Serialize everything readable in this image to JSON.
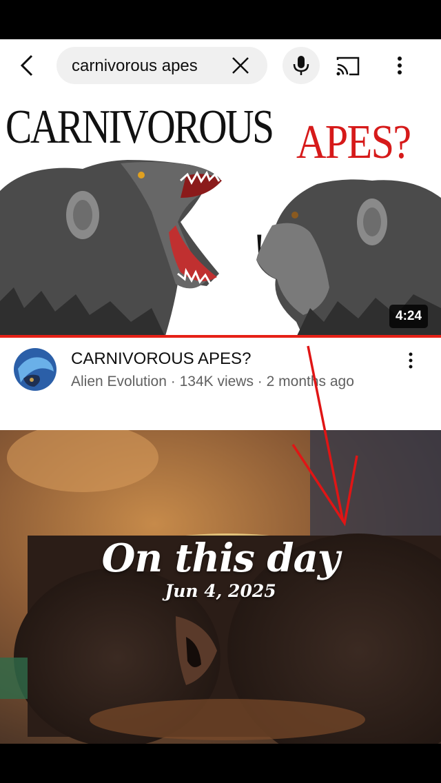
{
  "search": {
    "query": "carnivorous apes"
  },
  "video": {
    "thumbnail_title_black": "CARNIVOROUS",
    "thumbnail_title_red": "APES?",
    "thumbnail_exclaim": "!",
    "duration": "4:24",
    "title": "CARNIVOROUS APES?",
    "meta": "Alien Evolution · 134K views · 2 months ago"
  },
  "memory": {
    "title": "On this day",
    "date": "Jun 4, 2025"
  },
  "colors": {
    "accent_red": "#e62117",
    "title_red": "#d61a1a"
  },
  "icons": [
    "back-arrow-icon",
    "clear-icon",
    "mic-icon",
    "cast-icon",
    "more-vert-icon"
  ]
}
